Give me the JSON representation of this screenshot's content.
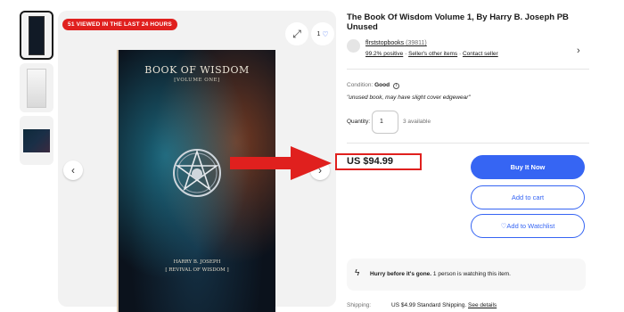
{
  "thumbnails": [
    {
      "icon": "book-cover-thumb"
    },
    {
      "icon": "book-back-thumb"
    },
    {
      "icon": "book-spread-thumb"
    }
  ],
  "viewer": {
    "badge": "51 VIEWED IN THE LAST 24 HOURS",
    "watch_count": "1",
    "book": {
      "title": "BOOK OF WISDOM",
      "volume": "[VOLUME ONE]",
      "author_line1": "HARRY B. JOSEPH",
      "author_line2": "[ REVIVAL OF WISDOM ]"
    }
  },
  "listing": {
    "title": "The Book Of Wisdom Volume 1, By Harry B. Joseph PB Unused",
    "seller": {
      "name": "flrststopbooks",
      "feedback_count": "(39811)",
      "positive": "99.2% positive",
      "other_items": "Seller's other items",
      "contact": "Contact seller"
    },
    "condition": {
      "label": "Condition:",
      "value": "Good",
      "note": "\"unused book, may have slight cover edgewear\""
    },
    "quantity": {
      "label": "Quantity:",
      "value": "1",
      "available": "3 available"
    },
    "price": "US $94.99",
    "buttons": {
      "buy": "Buy It Now",
      "cart": "Add to cart",
      "watch": "Add to Watchlist"
    },
    "hurry": {
      "bold": "Hurry before it's gone.",
      "rest": "1 person is watching this item."
    },
    "shipping": {
      "label": "Shipping:",
      "value": "US $4.99 Standard Shipping.",
      "details": "See details"
    }
  },
  "colors": {
    "accent": "#3665f3",
    "badge": "#e0201e",
    "annotation": "#e0201e"
  }
}
